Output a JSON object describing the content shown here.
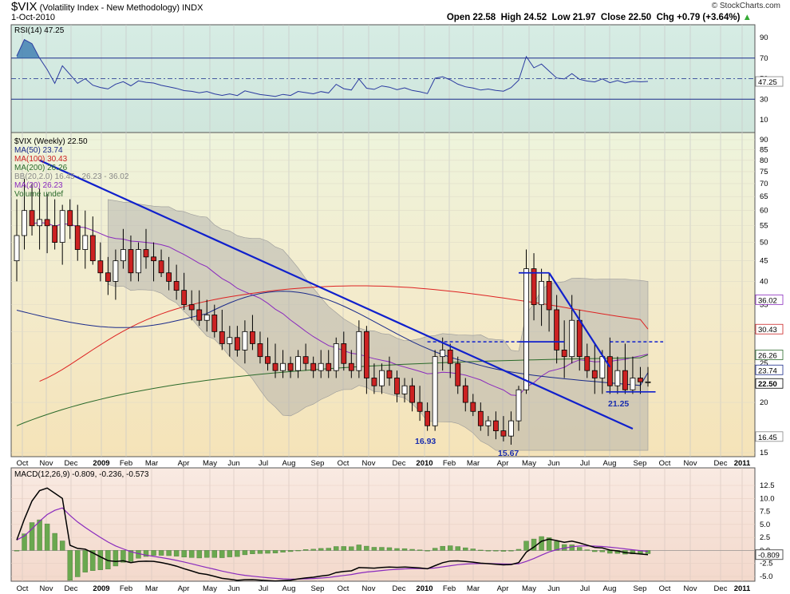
{
  "header": {
    "symbol": "$VIX",
    "name": "(Volatility Index - New Methodology)",
    "exchange": "INDX",
    "date": "1-Oct-2010",
    "brand": "© StockCharts.com",
    "ohlc": {
      "open": "Open 22.58",
      "high": "High 24.52",
      "low": "Low 21.97",
      "close": "Close 22.50",
      "chg": "Chg +0.79 (+3.64%)",
      "chg_arrow": "▲"
    }
  },
  "colors": {
    "up": "#ffffff",
    "down": "#cc2222",
    "ma50": "#1a2a8a",
    "ma100": "#d22",
    "ma200": "#2a6a2a",
    "ma20": "#8a2abe",
    "bb": "#b8b8b8",
    "trend": "#1020cc",
    "rsi": "#2a3aa0",
    "macd": "#000000",
    "signal": "#8a2abe",
    "hist": "#6aa84f"
  },
  "months": [
    "Oct",
    "Nov",
    "Dec",
    "2009",
    "Feb",
    "Mar",
    "Apr",
    "May",
    "Jun",
    "Jul",
    "Aug",
    "Sep",
    "Oct",
    "Nov",
    "Dec",
    "2010",
    "Feb",
    "Mar",
    "Apr",
    "May",
    "Jun",
    "Jul",
    "Aug",
    "Sep",
    "Oct",
    "Nov",
    "Dec",
    "2011"
  ],
  "rsi_panel": {
    "legend": "RSI(14) 47.25",
    "ticks": [
      "90",
      "70",
      "50",
      "30",
      "10"
    ],
    "current": "47.25"
  },
  "price_panel": {
    "legend": [
      "$VIX (Weekly) 22.50",
      "MA(50) 23.74",
      "MA(100) 30.43",
      "MA(200) 26.26",
      "BB(20,2.0) 16.45 - 26.23 - 36.02",
      "MA(20) 26.23",
      "Volume undef"
    ],
    "ticks": [
      "90",
      "85",
      "80",
      "75",
      "70",
      "65",
      "60",
      "55",
      "50",
      "45",
      "40",
      "35",
      "30",
      "25",
      "20",
      "15"
    ],
    "tags": {
      "ma20": "36.02",
      "ma100": "30.43",
      "ma200": "26.26",
      "ma50": "23.74",
      "close": "22.50",
      "bb_low": "16.45"
    },
    "annotations": [
      "16.93",
      "15.67",
      "21.25"
    ]
  },
  "macd_panel": {
    "legend": "MACD(12,26,9) -0.809, -0.236, -0.573",
    "ticks": [
      "12.5",
      "10.0",
      "7.5",
      "5.0",
      "2.5",
      "0.0",
      "-2.5",
      "-5.0"
    ],
    "current": "-0.809"
  },
  "chart_data": {
    "type": "candlestick",
    "title": "$VIX (Volatility Index - New Methodology) INDX",
    "period": "Weekly",
    "y_scale": "log",
    "ylim": [
      15,
      90
    ],
    "x_range": [
      "Oct 2008",
      "Oct 2010"
    ],
    "candles_ohlc": [
      [
        45,
        64,
        40,
        52
      ],
      [
        52,
        72,
        48,
        60
      ],
      [
        60,
        70,
        52,
        55
      ],
      [
        55,
        68,
        48,
        57
      ],
      [
        57,
        66,
        47,
        55
      ],
      [
        55,
        64,
        48,
        50
      ],
      [
        50,
        62,
        44,
        60
      ],
      [
        60,
        64,
        51,
        55
      ],
      [
        55,
        62,
        45,
        48
      ],
      [
        48,
        60,
        43,
        52
      ],
      [
        52,
        58,
        44,
        45
      ],
      [
        45,
        50,
        40,
        42
      ],
      [
        42,
        46,
        37,
        40
      ],
      [
        40,
        48,
        36,
        45
      ],
      [
        45,
        54,
        43,
        48
      ],
      [
        48,
        52,
        40,
        42
      ],
      [
        42,
        50,
        40,
        48
      ],
      [
        48,
        54,
        43,
        46
      ],
      [
        46,
        50,
        40,
        45
      ],
      [
        45,
        48,
        41,
        42
      ],
      [
        42,
        46,
        38,
        40
      ],
      [
        40,
        44,
        36,
        38
      ],
      [
        38,
        42,
        34,
        35
      ],
      [
        35,
        38,
        32,
        34
      ],
      [
        34,
        38,
        31,
        32
      ],
      [
        32,
        36,
        30,
        33
      ],
      [
        33,
        35,
        29,
        30
      ],
      [
        30,
        34,
        27,
        28
      ],
      [
        28,
        31,
        26,
        29
      ],
      [
        29,
        31,
        26,
        27
      ],
      [
        27,
        32,
        25,
        30
      ],
      [
        30,
        33,
        27,
        28
      ],
      [
        28,
        30,
        25,
        26
      ],
      [
        26,
        29,
        24,
        25
      ],
      [
        25,
        28,
        23,
        24
      ],
      [
        24,
        27,
        23,
        25
      ],
      [
        25,
        26,
        23,
        24
      ],
      [
        24,
        27,
        23,
        26
      ],
      [
        26,
        28,
        24,
        25
      ],
      [
        25,
        26,
        23,
        24
      ],
      [
        24,
        27,
        23,
        25
      ],
      [
        25,
        27,
        23,
        24
      ],
      [
        24,
        29,
        23,
        28
      ],
      [
        28,
        30,
        24,
        25
      ],
      [
        25,
        27,
        23,
        24
      ],
      [
        24,
        32,
        23,
        30
      ],
      [
        30,
        31,
        21,
        23
      ],
      [
        23,
        25,
        21,
        22
      ],
      [
        22,
        25,
        21,
        24
      ],
      [
        24,
        26,
        22,
        23
      ],
      [
        23,
        24,
        20,
        21
      ],
      [
        21,
        23,
        20,
        22
      ],
      [
        22,
        23,
        19,
        20
      ],
      [
        20,
        22,
        18,
        19
      ],
      [
        19,
        20,
        17,
        17.5
      ],
      [
        17.5,
        27,
        17,
        26
      ],
      [
        26,
        29,
        24,
        27
      ],
      [
        27,
        28,
        23,
        25
      ],
      [
        25,
        26,
        21,
        22
      ],
      [
        22,
        23,
        19,
        20
      ],
      [
        20,
        21,
        18.5,
        19
      ],
      [
        19,
        20,
        17,
        17.5
      ],
      [
        17.5,
        18.5,
        16.5,
        18
      ],
      [
        18,
        19,
        16.2,
        17
      ],
      [
        17,
        18.5,
        16,
        16.5
      ],
      [
        16.5,
        19,
        15.7,
        18
      ],
      [
        18,
        22,
        17,
        21.5
      ],
      [
        21.5,
        48,
        21,
        43
      ],
      [
        43,
        47,
        32,
        35
      ],
      [
        35,
        43,
        31,
        40
      ],
      [
        40,
        42,
        30,
        34
      ],
      [
        34,
        37,
        25,
        27
      ],
      [
        27,
        32,
        23,
        26
      ],
      [
        26,
        37,
        25,
        32
      ],
      [
        32,
        34,
        24,
        26
      ],
      [
        26,
        28,
        23,
        24
      ],
      [
        24,
        28,
        21,
        23
      ],
      [
        23,
        27,
        21,
        26
      ],
      [
        26,
        29,
        21,
        22
      ],
      [
        22,
        26,
        21,
        24
      ],
      [
        24,
        28,
        21,
        21.5
      ],
      [
        21.5,
        26,
        21,
        23
      ],
      [
        23,
        24.5,
        21,
        22.5
      ],
      [
        22.5,
        24.5,
        21.9,
        22.5
      ]
    ],
    "trendlines": [
      {
        "from": [
          "Oct 2008",
          80
        ],
        "to": [
          "Oct 2010",
          17
        ]
      },
      {
        "from": [
          "May 2010",
          42
        ],
        "to": [
          "Aug 2010",
          24
        ]
      }
    ],
    "levels": [
      28.3,
      21.25
    ],
    "macd": {
      "series": "MACD(12,26,9)",
      "values": [
        -0.809,
        -0.236,
        -0.573
      ]
    }
  }
}
